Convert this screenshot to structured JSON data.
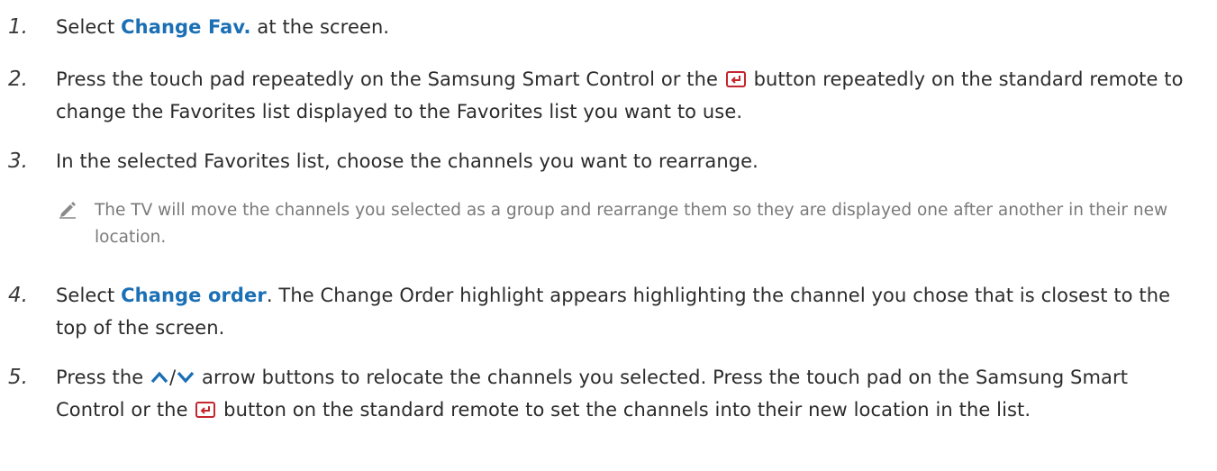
{
  "steps": [
    {
      "number": "1.",
      "before": "Select ",
      "highlight": "Change Fav.",
      "after": " at the screen."
    },
    {
      "number": "2.",
      "part1": "Press the touch pad repeatedly on the Samsung Smart Control or the ",
      "icon": "enter-icon",
      "part2": " button repeatedly on the standard remote to change the Favorites list displayed to the Favorites list you want to use."
    },
    {
      "number": "3.",
      "text": "In the selected Favorites list, choose the channels you want to rearrange."
    },
    {
      "number": "4.",
      "before": "Select ",
      "highlight": "Change order",
      "after": ". The Change Order highlight appears highlighting the channel you chose that is closest to the top of the screen."
    },
    {
      "number": "5.",
      "part1": "Press the ",
      "arrows_icons": [
        "up-arrow-icon",
        "down-arrow-icon"
      ],
      "arrow_sep": "/",
      "part2": " arrow buttons to relocate the channels you selected. Press the touch pad on the Samsung Smart Control or the ",
      "icon": "enter-icon",
      "part3": " button on the standard remote to set the channels into their new location in the list."
    }
  ],
  "note": {
    "icon": "pencil-note-icon",
    "text": "The TV will move the channels you selected as a group and rearrange them so they are displayed one after another in their new location."
  },
  "colors": {
    "highlight": "#1a6fb5",
    "body_text": "#2b2b2b",
    "note_text": "#7a7a7a"
  }
}
